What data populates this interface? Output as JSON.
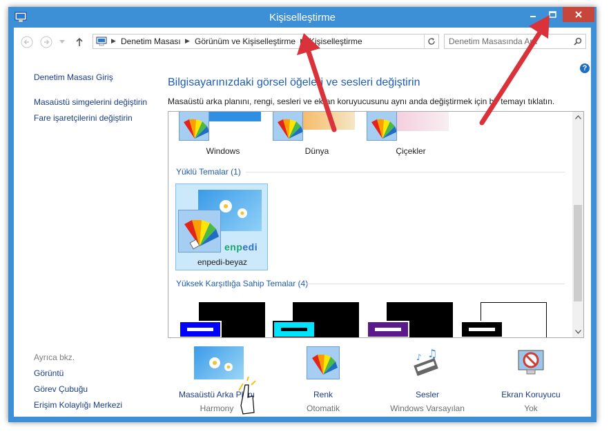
{
  "window": {
    "title": "Kişiselleştirme",
    "controls": [
      "minimize-icon",
      "maximize-icon",
      "close-icon"
    ]
  },
  "addressbar": {
    "breadcrumbs": [
      "Denetim Masası",
      "Görünüm ve Kişiselleştirme",
      "Kişiselleştirme"
    ],
    "search_placeholder": "Denetim Masasında Ara"
  },
  "sidebar": {
    "home": "Denetim Masası Giriş",
    "links": [
      "Masaüstü simgelerini değiştirin",
      "Fare işaretçilerini değiştirin"
    ],
    "see_also_title": "Ayrıca bkz.",
    "see_also": [
      "Görüntü",
      "Görev Çubuğu",
      "Erişim Kolaylığı Merkezi"
    ]
  },
  "main": {
    "heading": "Bilgisayarınızdaki görsel öğeleri ve sesleri değiştirin",
    "description": "Masaüstü arka planını, rengi, sesleri ve ekran koruyucusunu aynı anda değiştirmek için bir temayı tıklatın.",
    "windows_themes": [
      "Windows",
      "Dünya",
      "Çiçekler"
    ],
    "installed_group": "Yüklü Temalar (1)",
    "installed_themes": [
      {
        "name": "enpedi-beyaz",
        "logo": "enpedi",
        "selected": true
      }
    ],
    "high_contrast_group": "Yüksek Karşıtlığa Sahip Temalar (4)",
    "high_contrast_colors": [
      "#0000ff",
      "#00e5ff",
      "#5a1a8c",
      "#000000"
    ]
  },
  "bottom": [
    {
      "label": "Masaüstü Arka Planı",
      "value": "Harmony"
    },
    {
      "label": "Renk",
      "value": "Otomatik"
    },
    {
      "label": "Sesler",
      "value": "Windows Varsayılan"
    },
    {
      "label": "Ekran Koruyucu",
      "value": "Yok"
    }
  ],
  "colors": {
    "frame": "#3d8fd6",
    "close": "#c7463c",
    "link": "#1a3b88",
    "heading": "#1e5cb3",
    "annotation_arrow": "#d9323a"
  }
}
